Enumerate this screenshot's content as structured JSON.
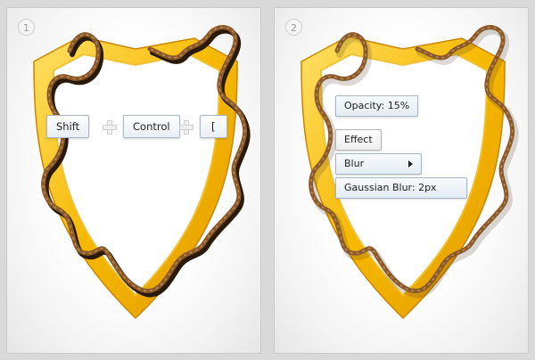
{
  "colors": {
    "shield_light": "#ffd84a",
    "shield_mid": "#f5b400",
    "shield_dark": "#d98e00",
    "rope": "#8a5a2b",
    "rope_dark": "#4d3015",
    "key_border": "#a9b8c6"
  },
  "step1": {
    "badge": "1",
    "keys": [
      "Shift",
      "Control",
      "["
    ]
  },
  "step2": {
    "badge": "2",
    "opacity_label": "Opacity: 15%",
    "effect_label": "Effect",
    "blur_label": "Blur",
    "gaussian_label": "Gaussian Blur: 2px"
  }
}
